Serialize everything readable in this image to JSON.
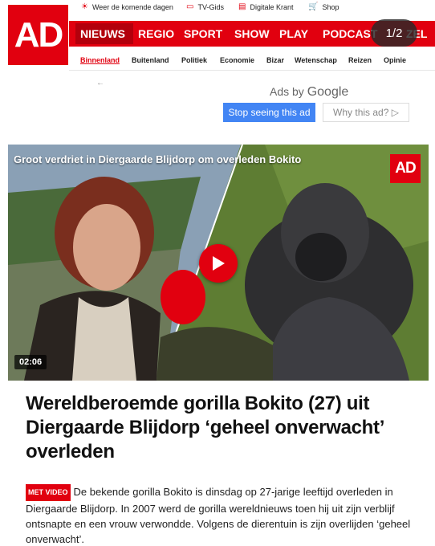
{
  "utility_links": [
    {
      "icon": "weather-icon",
      "label": "Weer de komende dagen"
    },
    {
      "icon": "tv-icon",
      "label": "TV-Gids"
    },
    {
      "icon": "newspaper-icon",
      "label": "Digitale Krant"
    },
    {
      "icon": "cart-icon",
      "label": "Shop"
    }
  ],
  "logo": {
    "text": "AD"
  },
  "main_nav": [
    "NIEUWS",
    "REGIO",
    "SPORT",
    "SHOW",
    "PLAY",
    "PODCAST",
    "ZEL"
  ],
  "pager": "1/2",
  "sub_nav": [
    "Binnenland",
    "Buitenland",
    "Politiek",
    "Economie",
    "Bizar",
    "Wetenschap",
    "Reizen",
    "Opinie"
  ],
  "ad": {
    "back": "←",
    "ads_by": "Ads by",
    "google": "Google",
    "stop": "Stop seeing this ad",
    "why": "Why this ad? ▷"
  },
  "video": {
    "title": "Groot verdriet in Diergaarde Blijdorp om overleden Bokito",
    "logo": "AD",
    "duration": "02:06"
  },
  "article": {
    "headline": "Wereldberoemde gorilla Bokito (27) uit Diergaarde Blijdorp ‘geheel onverwacht’ overleden",
    "badge": "MET VIDEO",
    "lead": "De bekende gorilla Bokito is dinsdag op 27-jarige leeftijd overleden in Diergaarde Blijdorp. In 2007 werd de gorilla wereldnieuws toen hij uit zijn verblijf ontsnapte en een vrouw verwondde. Volgens de dierentuin is zijn overlijden ‘geheel onverwacht’."
  },
  "colors": {
    "brand_red": "#e1000f",
    "google_blue": "#4285f4"
  }
}
